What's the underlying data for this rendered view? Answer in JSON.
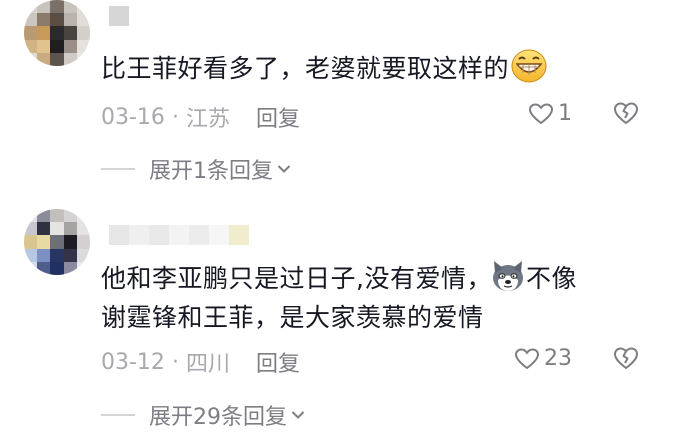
{
  "comments": [
    {
      "text": "比王菲好看多了，老婆就要取这样的",
      "emoji": "grinning-face-emoji",
      "date": "03-16",
      "separator": "·",
      "location": "江苏",
      "reply_label": "回复",
      "like_count": "1",
      "expand_label": "展开1条回复"
    },
    {
      "text_line1": "他和李亚鹏只是过日子,没有爱情，",
      "emoji": "dog-face-emoji",
      "text_line1_end": "不像",
      "text_line2": "谢霆锋和王菲，是大家羡慕的爱情",
      "date": "03-12",
      "separator": "·",
      "location": "四川",
      "reply_label": "回复",
      "like_count": "23",
      "expand_label": "展开29条回复"
    }
  ],
  "colors": {
    "text": "#161823",
    "meta": "#a8a8ae",
    "action": "#7d7d84"
  }
}
